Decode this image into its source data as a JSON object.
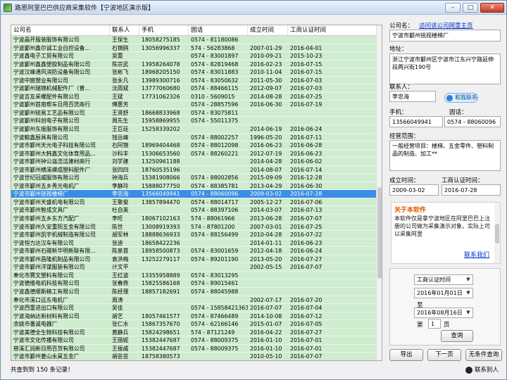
{
  "window": {
    "title": "路恩阿里巴巴供应商采集软件【宁波地区演示版】"
  },
  "grid": {
    "headers": [
      "公司名",
      "联系人",
      "手机",
      "固话",
      "成立时间",
      "工商认证时间"
    ],
    "rows": [
      [
        "宁波晶开服装服饰有限公司",
        "王保生",
        "18058275185",
        "0574 - 81180086",
        "",
        ""
      ],
      [
        "宁波鄞州鑫尔诚工业自控设备…",
        "石锦鸥",
        "13056996337",
        "574 - 56283868",
        "2007-01-29",
        "2016-04-01"
      ],
      [
        "宁波鑫电子工贸有限公司",
        "吴蕾",
        "",
        "0574 - 83001897",
        "2010-09-21",
        "2015-10-23"
      ],
      [
        "宁波鄞州鑫鑫塑胶制品有限公司",
        "陈宗武",
        "13958264078",
        "0574 - 82819468",
        "2016-02-23",
        "2016-07-15"
      ],
      [
        "宁波汉峰通风消防设备有限公司",
        "张彬飞",
        "18968205150",
        "0574 - 83011883",
        "2010-11-04",
        "2016-07-15"
      ],
      [
        "宁波中宸塑业有限公司",
        "张永凡",
        "13989300716",
        "0574 - 83050632",
        "2011-05-30",
        "2016-07-03"
      ],
      [
        "宁波鄞州瑞锦机械配件厂（普…",
        "沈雨斌",
        "13777060680",
        "0574 - 88466115",
        "2012-09-07",
        "2016-07-03"
      ],
      [
        "宁波吉友采暖配件有限公司",
        "王斌",
        "17731062326",
        "0310 - 5609015",
        "2014-08-28",
        "2016-07-25"
      ],
      [
        "宁波鄞州首南帮车日用百货商行",
        "傅惠芳",
        "",
        "0574 - 28857596",
        "2016-06-30",
        "2016-07-19"
      ],
      [
        "宁波鄞州锐易工艺品有限公司",
        "王贤舒",
        "18668833968",
        "0574 - 83075811",
        "",
        ""
      ],
      [
        "宁波鄞州科创电子有限公司",
        "周先生",
        "15958869955",
        "0574 - 55011375",
        "",
        ""
      ],
      [
        "宁波鄞州东振服饰有限公司",
        "王巨廷",
        "15258339202",
        "",
        "2014-06-19",
        "2016-06-24"
      ],
      [
        "宁波鲸鑫厨具有限公司",
        "钱岳峰",
        "",
        "0574 - 88002257",
        "1996-05-20",
        "2016-07-11"
      ],
      [
        "宁波市鄞州天元电子科技有限公司",
        "石阿锦",
        "18969404468",
        "0574 - 88012098",
        "2016-06-23",
        "2016-06-28"
      ],
      [
        "宁波市鄞州大韩鑫文化体育用品…",
        "沙科丰",
        "15306653560",
        "0574 - 88260221",
        "2012-07-19",
        "2016-06-23"
      ],
      [
        "宁波市鄞州钟公庙浩洁建材商行",
        "刘学建",
        "13250961188",
        "",
        "2014-04-28",
        "2016-06-02"
      ],
      [
        "宁波市鄞州横溪嵘成塑料配件厂",
        "张四四",
        "18760535196",
        "",
        "2014-08-07",
        "2016-07-14"
      ],
      [
        "宁波世纪冠威服饰有限公司",
        "钟海兵",
        "15381908066",
        "0574 - 88002856",
        "2015-09-09",
        "2016-12-28"
      ],
      [
        "宁波市鄞州五乡秀光电机厂",
        "李静玲",
        "15888077750",
        "0574 - 88385781",
        "2013-04-29",
        "2016-06-30"
      ],
      [
        "宁波市鄞州锐视楼梯厂",
        "李忠海",
        "13566049941",
        "0574 - 88060096",
        "2009-03-02",
        "2016-07-28"
      ],
      [
        "宁波市鄞州天盛机电有限公司",
        "王聚俊",
        "13857894470",
        "0574 - 88014717",
        "2005-12-27",
        "2016-07-06"
      ],
      [
        "宁波市鄞州智成文具厂",
        "杜自英",
        "",
        "0574 - 88397106",
        "2014-03-07",
        "2016-07-13"
      ],
      [
        "宁波市鄞州五乡东方汽配厂",
        "李旺",
        "18067102163",
        "574 - 88061966",
        "2013-06-28",
        "2016-07-07"
      ],
      [
        "宁波市鄞州久安重阳五金有限公司",
        "陈世",
        "13008919393",
        "574 - 87801200",
        "2007-03-01",
        "2016-07-25"
      ],
      [
        "宁波市鄞州凯宇机械制造有限公司",
        "胡军林",
        "18888636933",
        "0574 - 88156499",
        "2010-04-28",
        "2016-07-22"
      ],
      [
        "宁波恒力达汉车有限公司",
        "张迪",
        "18658422236",
        "",
        "2014-01-11",
        "2016-06-23"
      ],
      [
        "宁波市鄞州石碶新华明新联有限…",
        "陈泉首",
        "18958500873",
        "0574 - 83001659",
        "2012-04-18",
        "2016-06-24"
      ],
      [
        "宁波市鄞州昌隆机制品有限公司",
        "袁洪梅",
        "13252279117",
        "0574 - 89201190",
        "2013-05-20",
        "2016-07-27"
      ],
      [
        "宁波市鄞州洋谋服装有限公司",
        "计文平",
        "",
        "",
        "2002-05-15",
        "2016-07-07"
      ],
      [
        "奉化市赛文塑料有限公司",
        "王红波",
        "13355958889",
        "0574 - 83013295",
        "",
        ""
      ],
      [
        "宁波德维电机科技有限公司",
        "张春燕",
        "15825586168",
        "0574 - 89015461",
        "",
        ""
      ],
      [
        "宁波鑫德顺斯精工有限公司",
        "陈经理",
        "18857182691",
        "0574 - 88045988",
        "",
        ""
      ],
      [
        "奉化市溪口远东电机厂",
        "周涛",
        "",
        "",
        "2002-07-17",
        "2016-07-20"
      ],
      [
        "宁波西雷进出口有限公司",
        "吴佳",
        "",
        "0574 - 15858421363",
        "2016-07-07",
        "2016-07-04"
      ],
      [
        "宁波海纳达新材料有限公司",
        "胡艺",
        "18057461577",
        "0574 - 87466489",
        "2014-10-08",
        "2016-07-12"
      ],
      [
        "余姚市番诚电器厂",
        "张仁水",
        "15867357670",
        "0574 - 62166146",
        "2015-01-07",
        "2016-07-05"
      ],
      [
        "宁波美德全生物科技有限公司",
        "黄静兵",
        "15824298651",
        "574 - 87121249",
        "2016-04-22",
        "2016-07-27"
      ],
      [
        "宁波市文化传播有限公司",
        "王丽妮",
        "15382447687",
        "0574 - 88009375",
        "2016-01-10",
        "2016-07-01"
      ],
      [
        "慈溪汇润新日用百货有限公司",
        "王振威",
        "15382447687",
        "0574 - 88009375",
        "2016-01-10",
        "2016-07-01"
      ],
      [
        "宁波市鄞州姜山永昊五金厂",
        "胡芸芸",
        "18758380573",
        "",
        "2010-05-10",
        "2016-07-07"
      ],
      [
        "宁波市鄞州传成融盛设备有限公司",
        "郭敏",
        "15355160217",
        "",
        "2014-11-27",
        "2016-06-24"
      ],
      [
        "宁波市鄞州新科五金有限公司",
        "邹科",
        "",
        "0574 - 88405150",
        "2016-06-24",
        "2016-06-27"
      ]
    ],
    "selected_index": 19
  },
  "status": {
    "text": "共查到到 150 条记录！",
    "contact": "联系别人"
  },
  "panel": {
    "company_label": "公司名：",
    "visit_link": "访问该公司网里主页",
    "company_value": "宁波市鄞州锐视楼梯厂",
    "address_label": "地址：",
    "address_value": "浙江宁波市鄞州区宁波市江东兴宁路延伸段两兴街190号",
    "contact_label": "联系人：",
    "contact_value": "李忠海",
    "qq_label": "和我联系",
    "mobile_label": "手机：",
    "mobile_value": "13566049941",
    "phone_label": "固话：",
    "phone_value": "0574 - 88060096",
    "scope_label": "经营范围：",
    "scope_value": "一般经营项目：楼梯、五金零件、塑料制品的制造、加工**",
    "founded_label": "成立时间：",
    "founded_value": "2009-03-02",
    "cert_label": "工商认证时间：",
    "cert_value": "2016-07-28",
    "about_title": "关于本软件",
    "about_text": "本软件仅是拿宁波地区在阿里巴巴上注册的公司做为采集演示对象，实际上可以采集阿里",
    "about_link": "联系我们"
  },
  "filter": {
    "type_value": "工商认证时间",
    "from_date": "2016年01月01日",
    "to_label": "至",
    "to_date": "2016年08月16日",
    "page_prefix": "第",
    "page_value": "1",
    "page_suffix": "页",
    "query_button": "查询"
  },
  "buttons": {
    "export": "导出",
    "next": "下一页",
    "unconditional": "无条件查询"
  }
}
